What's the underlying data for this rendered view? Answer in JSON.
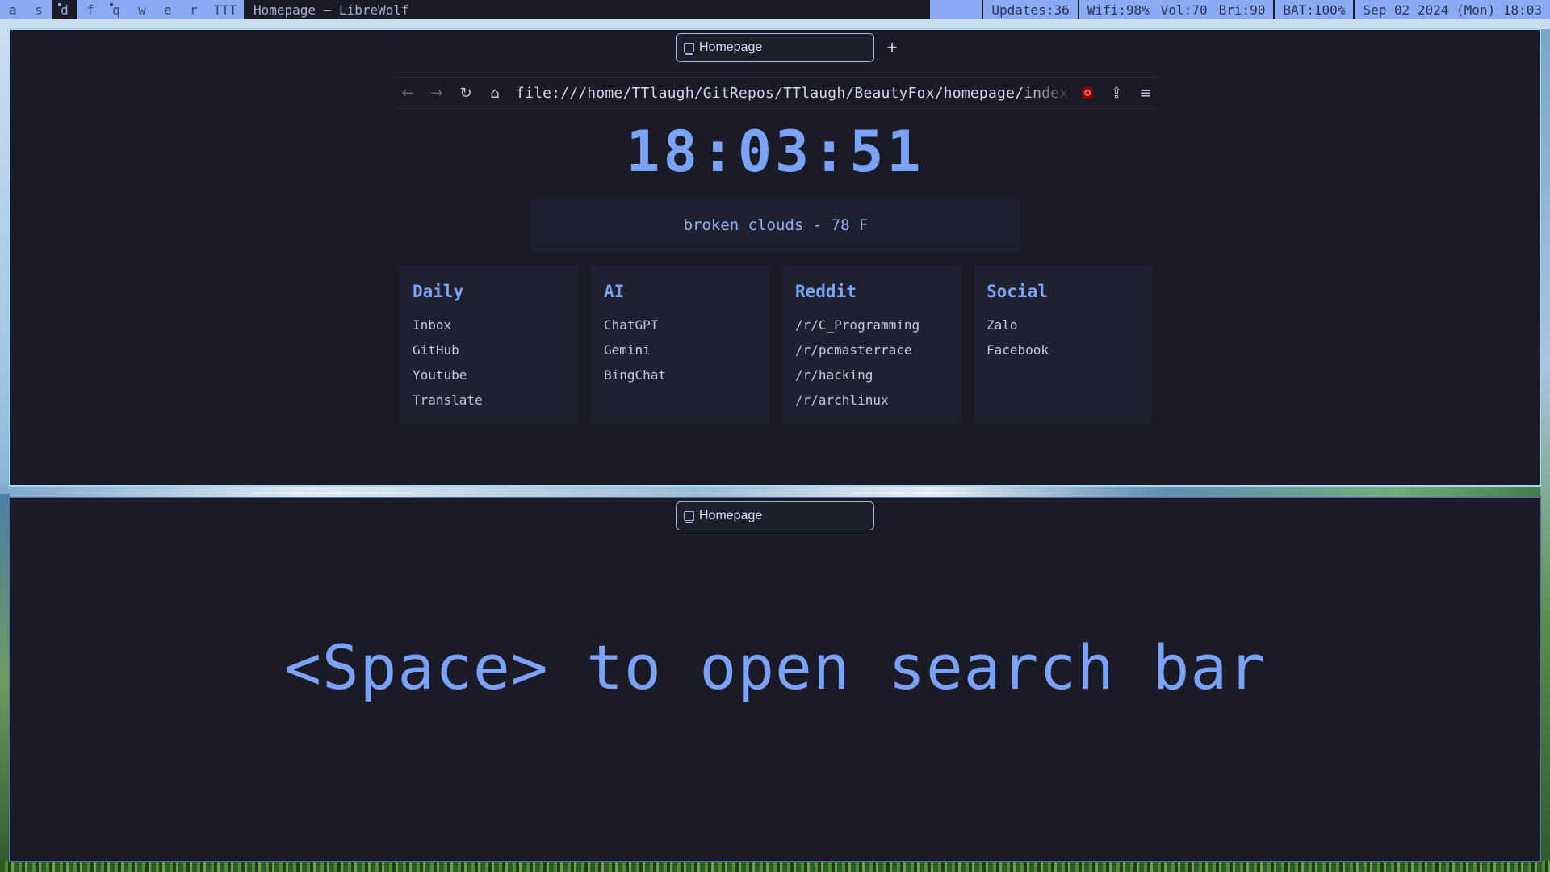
{
  "topbar": {
    "workspaces": [
      {
        "key": "a",
        "occupied": false,
        "active": false
      },
      {
        "key": "s",
        "occupied": false,
        "active": false
      },
      {
        "key": "d",
        "occupied": true,
        "active": true
      },
      {
        "key": "f",
        "occupied": false,
        "active": false
      },
      {
        "key": "q",
        "occupied": true,
        "active": false
      },
      {
        "key": "w",
        "occupied": false,
        "active": false
      },
      {
        "key": "e",
        "occupied": false,
        "active": false
      },
      {
        "key": "r",
        "occupied": false,
        "active": false
      },
      {
        "key": "TTT",
        "occupied": false,
        "active": false
      }
    ],
    "window_title": "Homepage — LibreWolf",
    "status": {
      "updates": "Updates:36",
      "wifi": "Wifi:98%",
      "vol": "Vol:70",
      "bri": "Bri:90",
      "bat": "BAT:100%",
      "datetime": "Sep 02 2024 (Mon) 18:03"
    }
  },
  "window1": {
    "tab": {
      "label": "Homepage",
      "new_tab": "+"
    },
    "navbar": {
      "back_icon": "←",
      "forward_icon": "→",
      "reload_icon": "↻",
      "home_icon": "⌂",
      "url": "file:///home/TTlaugh/GitRepos/TTlaugh/BeautyFox/homepage/index.html",
      "extensions_icon": "⇪",
      "menu_icon": "≡"
    },
    "clock": "18:03:51",
    "weather": "broken clouds - 78 F",
    "cards": [
      {
        "title": "Daily",
        "links": [
          "Inbox",
          "GitHub",
          "Youtube",
          "Translate"
        ]
      },
      {
        "title": "AI",
        "links": [
          "ChatGPT",
          "Gemini",
          "BingChat"
        ]
      },
      {
        "title": "Reddit",
        "links": [
          "/r/C_Programming",
          "/r/pcmasterrace",
          "/r/hacking",
          "/r/archlinux"
        ]
      },
      {
        "title": "Social",
        "links": [
          "Zalo",
          "Facebook"
        ]
      }
    ]
  },
  "window2": {
    "tab": {
      "label": "Homepage"
    },
    "hint": "<Space> to open search bar"
  },
  "colors": {
    "accent": "#7aa2f7",
    "bar": "#8aabf4",
    "background": "#1a1b26",
    "card": "#1f2130",
    "focused_border": "#a6d9ef"
  }
}
